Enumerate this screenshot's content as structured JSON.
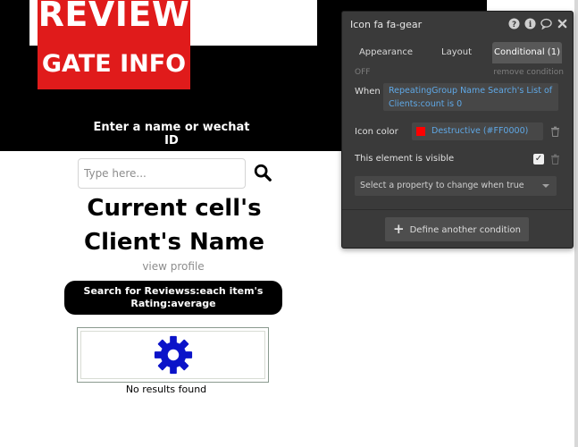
{
  "page": {
    "logo": {
      "line1": "REVIEW",
      "line2": "GATE INFO"
    },
    "hero_label": "Enter a name or wechat ID",
    "search": {
      "placeholder": "Type here...",
      "value": ""
    },
    "client_name": "Current cell's Client's Name",
    "view_profile": "view profile",
    "reviews_button": "Search for Reviewss:each item's Rating:average",
    "no_results": "No results found",
    "gear_color": "#0b13c9"
  },
  "panel": {
    "title": "Icon fa fa-gear",
    "header_icons": [
      "help-icon",
      "info-icon",
      "comment-icon",
      "close-icon"
    ],
    "tabs": [
      {
        "label": "Appearance",
        "active": false
      },
      {
        "label": "Layout",
        "active": false
      },
      {
        "label": "Conditional (1)",
        "active": true
      }
    ],
    "off_label": "OFF",
    "remove_condition": "remove condition",
    "when_label": "When",
    "when_expression": "RepeatingGroup Name Search's List of Clients:count is 0",
    "icon_color_label": "Icon color",
    "icon_color_value": "Destructive (#FF0000)",
    "icon_color_hex": "#FF0000",
    "visible_label": "This element is visible",
    "visible_checked": true,
    "property_dropdown": "Select a property to change when true",
    "define_button": "Define another condition"
  }
}
